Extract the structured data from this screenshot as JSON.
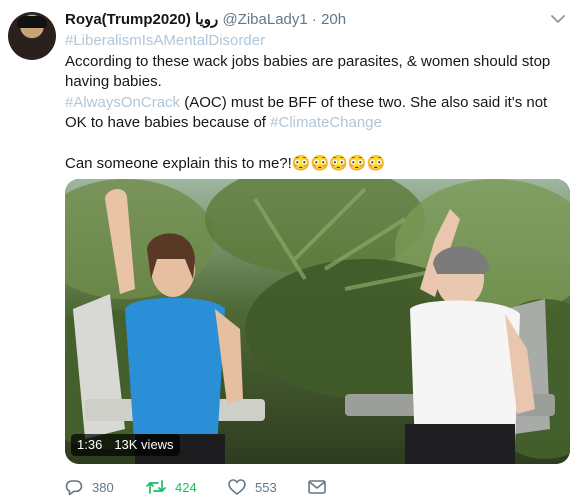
{
  "tweet": {
    "display_name": "Roya(Trump2020) رویا",
    "handle": "@ZibaLady1",
    "separator": "·",
    "time": "20h",
    "line1_hashtag": "#LiberalismIsAMentalDisorder",
    "line2": "According to these wack jobs babies are parasites, & women should stop having babies.",
    "line3_hashtag": "#AlwaysOnCrack",
    "line3_text": " (AOC) must be BFF of these two. She also said it's not OK to have babies because of ",
    "line3_hashtag2": "#ClimateChange",
    "line4_text": "Can someone explain this to me?!",
    "line4_emoji": "😳😳😳😳😳"
  },
  "video": {
    "duration": "1:36",
    "views": "13K views"
  },
  "actions": {
    "replies": "380",
    "retweets": "424",
    "likes": "553"
  },
  "icons": {
    "caret": "chevron-down-icon",
    "reply": "reply-icon",
    "retweet": "retweet-icon",
    "like": "heart-icon",
    "dm": "envelope-icon"
  },
  "colors": {
    "text": "#14171a",
    "muted": "#657786",
    "hashtag": "#b0c6d8",
    "retweet_active": "#17bf63"
  }
}
